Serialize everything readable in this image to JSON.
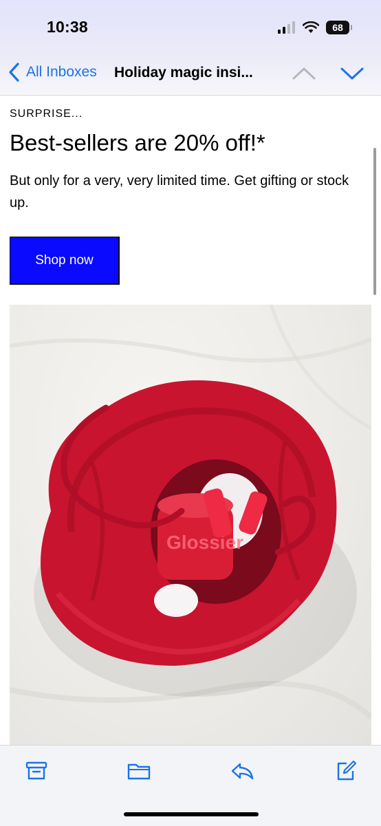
{
  "status_bar": {
    "time": "10:38",
    "battery": "68"
  },
  "nav": {
    "back_label": "All Inboxes",
    "title": "Holiday magic insi..."
  },
  "email": {
    "eyebrow": "SURPRISE...",
    "headline": "Best-sellers are 20% off!*",
    "body": "But only for a very, very limited time. Get gifting or stock up.",
    "cta_label": "Shop now",
    "cta_color": "#0a0aff",
    "hero_image": "red-drawstring-pouch-with-products",
    "hero_logo_text": "Glossier"
  },
  "toolbar": {
    "icons": [
      "archive-icon",
      "folder-icon",
      "reply-icon",
      "compose-icon"
    ]
  },
  "colors": {
    "accent": "#1a73e8",
    "pouch": "#c8142f",
    "background": "#ffffff"
  }
}
